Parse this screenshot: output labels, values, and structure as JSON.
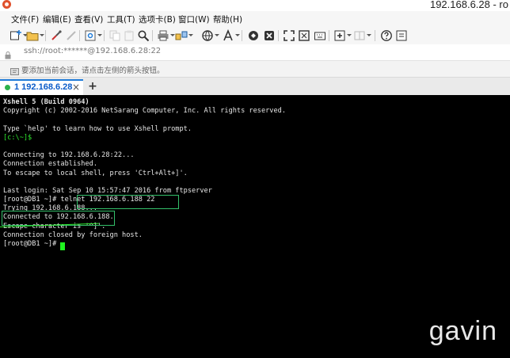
{
  "window": {
    "title": "192.168.6.28 - ro"
  },
  "menu": {
    "file": "文件(F)",
    "edit": "编辑(E)",
    "view": "查看(V)",
    "tools": "工具(T)",
    "tabs": "选项卡(B)",
    "window": "窗口(W)",
    "help": "帮助(H)"
  },
  "address": {
    "value": "ssh://root:******@192.168.6.28:22"
  },
  "hint": {
    "text": "要添加当前会话，请点击左侧的箭头按钮。"
  },
  "tab": {
    "active_label": "1 192.168.6.28",
    "close": "×",
    "add": "+"
  },
  "terminal": {
    "lines": [
      "Xshell 5 (Build 0964)",
      "Copyright (c) 2002-2016 NetSarang Computer, Inc. All rights reserved.",
      "",
      "Type `help' to learn how to use Xshell prompt.",
      "[c:\\~]$",
      "",
      "Connecting to 192.168.6.28:22...",
      "Connection established.",
      "To escape to local shell, press 'Ctrl+Alt+]'.",
      "",
      "Last login: Sat Sep 10 15:57:47 2016 from ftpserver",
      "[root@DB1 ~]# telnet 192.168.6.188 22",
      "Trying 192.168.6.188...",
      "Connected to 192.168.6.188.",
      "Escape character is '^]'.",
      "Connection closed by foreign host.",
      "[root@DB1 ~]# "
    ]
  },
  "watermark": "gavin",
  "colors": {
    "terminal_bg": "#000000",
    "terminal_fg": "#e6e6e6",
    "prompt_green": "#2ee62e",
    "highlight_box": "#33c06a",
    "tab_accent": "#1f7bd8"
  }
}
